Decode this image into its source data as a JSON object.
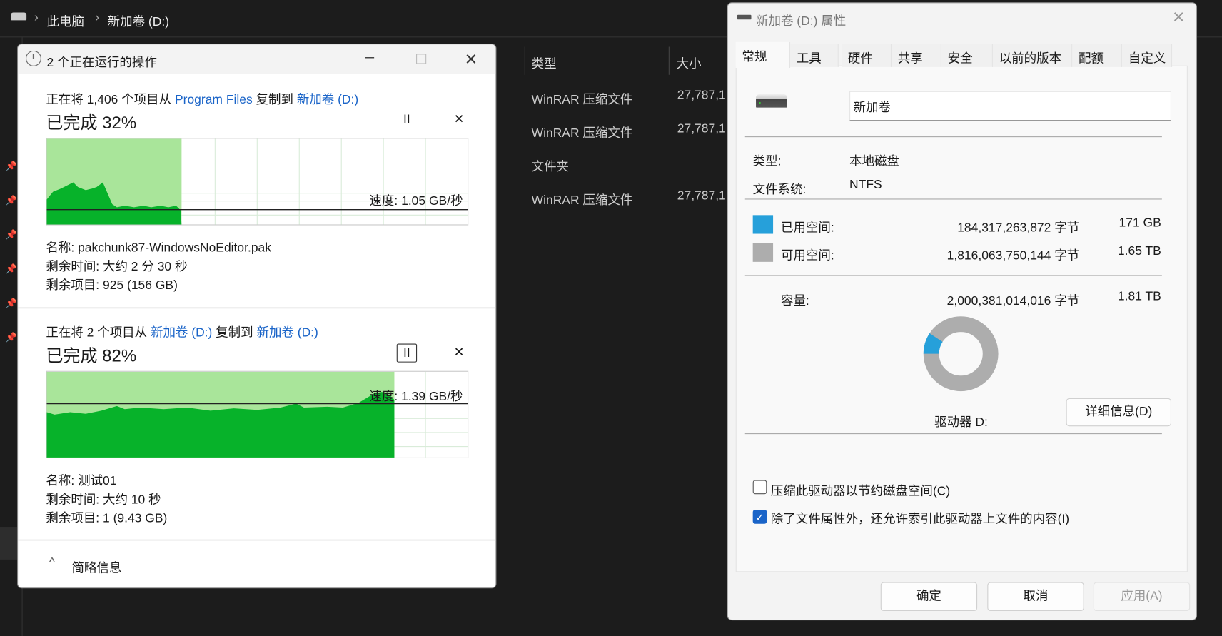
{
  "explorer": {
    "breadcrumb": [
      "此电脑",
      "新加卷 (D:)"
    ],
    "columns": [
      "类型",
      "大小"
    ],
    "rows": [
      {
        "type": "WinRAR 压缩文件",
        "size": "27,787,1"
      },
      {
        "type": "WinRAR 压缩文件",
        "size": "27,787,1"
      },
      {
        "type": "文件夹",
        "size": ""
      },
      {
        "type": "WinRAR 压缩文件",
        "size": "27,787,1"
      }
    ]
  },
  "copy_dialog": {
    "title": "2 个正在运行的操作",
    "ops": [
      {
        "desc_pre": "正在将 1,406 个项目从 ",
        "src": "Program Files",
        "mid": " 复制到 ",
        "dst": "新加卷 (D:)",
        "progress_label": "已完成 32%",
        "progress": 32,
        "speed": "速度: 1.05 GB/秒",
        "name_label": "名称:",
        "name": "pakchunk87-WindowsNoEditor.pak",
        "time_label": "剩余时间:",
        "time": "大约 2 分 30 秒",
        "items_label": "剩余项目:",
        "items": "925 (156 GB)"
      },
      {
        "desc_pre": "正在将 2 个项目从 ",
        "src": "新加卷 (D:)",
        "mid": " 复制到 ",
        "dst": "新加卷 (D:)",
        "progress_label": "已完成 82%",
        "progress": 82,
        "speed": "速度: 1.39 GB/秒",
        "name_label": "名称:",
        "name": "测试01",
        "time_label": "剩余时间:",
        "time": "大约 10 秒",
        "items_label": "剩余项目:",
        "items": "1 (9.43 GB)"
      }
    ],
    "pause_glyph": "II",
    "cancel_glyph": "✕",
    "footer": "简略信息"
  },
  "properties": {
    "title": "新加卷 (D:) 属性",
    "tabs": [
      "常规",
      "工具",
      "硬件",
      "共享",
      "安全",
      "以前的版本",
      "配额",
      "自定义"
    ],
    "volume_name": "新加卷",
    "type_label": "类型:",
    "type": "本地磁盘",
    "fs_label": "文件系统:",
    "fs": "NTFS",
    "used_label": "已用空间:",
    "used_bytes": "184,317,263,872 字节",
    "used_size": "171 GB",
    "free_label": "可用空间:",
    "free_bytes": "1,816,063,750,144 字节",
    "free_size": "1.65 TB",
    "cap_label": "容量:",
    "cap_bytes": "2,000,381,014,016 字节",
    "cap_size": "1.81 TB",
    "used_fraction": 0.092,
    "drive_label": "驱动器 D:",
    "details_button": "详细信息(D)",
    "compress_label": "压缩此驱动器以节约磁盘空间(C)",
    "compress_checked": false,
    "index_label": "除了文件属性外，还允许索引此驱动器上文件的内容(I)",
    "index_checked": true,
    "ok": "确定",
    "cancel": "取消",
    "apply": "应用(A)",
    "colors": {
      "used": "#26a0da",
      "free": "#adadad"
    }
  }
}
